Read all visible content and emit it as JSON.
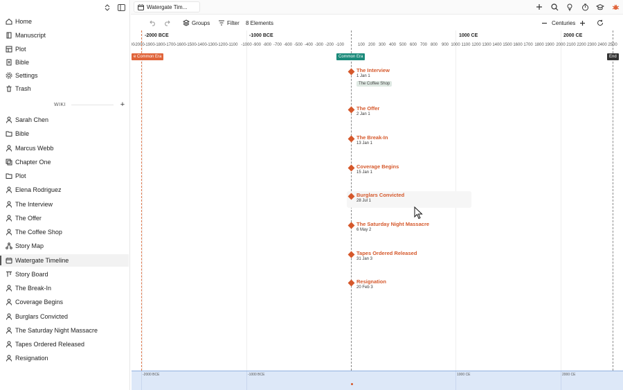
{
  "tab": {
    "title": "Watergate Tim..."
  },
  "sidebar": {
    "nav": [
      {
        "label": "Home",
        "icon": "home-icon"
      },
      {
        "label": "Manuscript",
        "icon": "book-icon"
      },
      {
        "label": "Plot",
        "icon": "plot-icon"
      },
      {
        "label": "Bible",
        "icon": "bible-icon"
      },
      {
        "label": "Settings",
        "icon": "gear-icon"
      },
      {
        "label": "Trash",
        "icon": "trash-icon"
      }
    ],
    "wiki_header": "WIKI",
    "wiki": [
      {
        "label": "Sarah Chen",
        "icon": "person-icon"
      },
      {
        "label": "Bible",
        "icon": "folder-icon"
      },
      {
        "label": "Marcus Webb",
        "icon": "person-icon"
      },
      {
        "label": "Chapter One",
        "icon": "chapter-icon"
      },
      {
        "label": "Plot",
        "icon": "folder-icon"
      },
      {
        "label": "Elena Rodriguez",
        "icon": "person-icon"
      },
      {
        "label": "The Interview",
        "icon": "person-icon"
      },
      {
        "label": "The Offer",
        "icon": "person-icon"
      },
      {
        "label": "The Coffee Shop",
        "icon": "person-icon"
      },
      {
        "label": "Story Map",
        "icon": "map-icon"
      },
      {
        "label": "Watergate Timeline",
        "icon": "calendar-icon",
        "active": true
      },
      {
        "label": "Story Board",
        "icon": "board-icon"
      },
      {
        "label": "The Break-In",
        "icon": "person-icon"
      },
      {
        "label": "Coverage Begins",
        "icon": "person-icon"
      },
      {
        "label": "Burglars Convicted",
        "icon": "person-icon"
      },
      {
        "label": "The Saturday Night Massacre",
        "icon": "person-icon"
      },
      {
        "label": "Tapes Ordered Released",
        "icon": "person-icon"
      },
      {
        "label": "Resignation",
        "icon": "person-icon"
      }
    ]
  },
  "toolbar": {
    "groups_label": "Groups",
    "filter_label": "Filter",
    "elements_count": "8 Elements",
    "zoom_label": "Centuries"
  },
  "timeline": {
    "major_ticks": [
      "-2000 BCE",
      "-1000 BCE",
      "1000 CE",
      "2000 CE"
    ],
    "minor_ticks": [
      "-2100",
      "-2000",
      "-1900",
      "-1800",
      "-1700",
      "-1600",
      "-1500",
      "-1400",
      "-1300",
      "-1200",
      "-1100",
      "-1000",
      "-900",
      "-800",
      "-700",
      "-600",
      "-500",
      "-400",
      "-300",
      "-200",
      "-100",
      "100",
      "200",
      "300",
      "400",
      "500",
      "600",
      "700",
      "800",
      "900",
      "1000",
      "1100",
      "1200",
      "1300",
      "1400",
      "1500",
      "1600",
      "1700",
      "1800",
      "1900",
      "2000",
      "2100",
      "2200",
      "2300",
      "2400",
      "2500"
    ],
    "markers": {
      "start": "e Common Era",
      "common_era": "Common Era",
      "end": "End"
    },
    "events": [
      {
        "title": "The Interview",
        "date": "1 Jan 1",
        "tag": "The Coffee Shop"
      },
      {
        "title": "The Offer",
        "date": "2 Jan 1"
      },
      {
        "title": "The Break-In",
        "date": "13 Jan 1"
      },
      {
        "title": "Coverage Begins",
        "date": "15 Jan 1"
      },
      {
        "title": "Burglars Convicted",
        "date": "28 Jul 1"
      },
      {
        "title": "The Saturday Night Massacre",
        "date": "6 May 2"
      },
      {
        "title": "Tapes Ordered Released",
        "date": "31 Jan 3"
      },
      {
        "title": "Resignation",
        "date": "20 Feb 3"
      }
    ]
  },
  "minimap": {
    "labels": [
      "-2000 BCE",
      "-1000 BCE",
      "1000 CE",
      "2000 CE"
    ]
  },
  "colors": {
    "event_accent": "#d5582b",
    "common_era_marker": "#1a8a7a",
    "start_marker": "#e0643a",
    "end_marker": "#333333",
    "minimap_bg": "#dde8f8"
  }
}
